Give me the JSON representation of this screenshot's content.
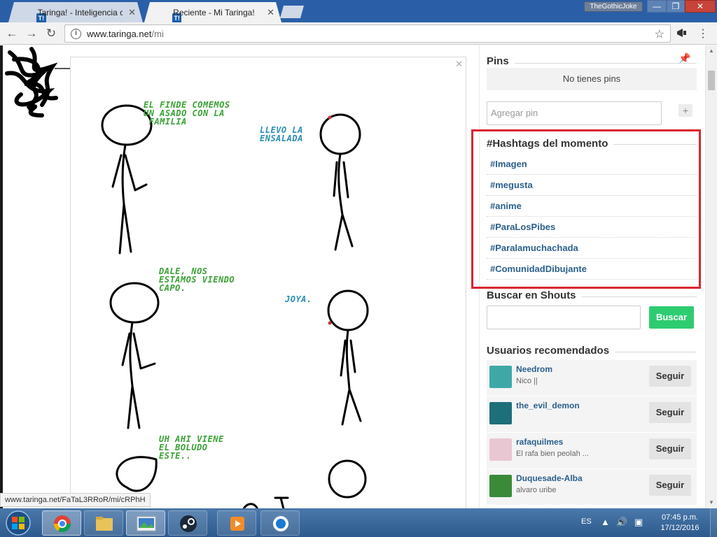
{
  "window": {
    "profile_name": "TheGothicJoke",
    "minimize_label": "—",
    "maximize_label": "❐",
    "close_label": "✕"
  },
  "tabs": [
    {
      "label": "Taringa! - Inteligencia co",
      "favicon": "T!",
      "active": false
    },
    {
      "label": "Reciente - Mi Taringa!",
      "favicon": "T!",
      "active": true
    }
  ],
  "toolbar": {
    "back_icon": "←",
    "forward_icon": "→",
    "reload_icon": "↻",
    "url_host": "www.taringa.net",
    "url_path": "/mi",
    "star_icon": "☆",
    "menu_icon": "⋮"
  },
  "comic": {
    "panels": [
      {
        "left_caption": "EL FINDE COMEMOS\nUN ASADO CON LA\n FAMILIA",
        "right_caption": "LLEVO LA\nENSALADA"
      },
      {
        "left_caption": "DALE, NOS\nESTAMOS VIENDO\nCAPO.",
        "right_caption": "JOYA."
      },
      {
        "left_caption": "UH AHI VIENE\nEL BOLUDO\nESTE..",
        "right_caption": ""
      }
    ]
  },
  "sidebar": {
    "pins_title": "Pins",
    "pins_empty": "No tienes pins",
    "pin_placeholder": "Agregar pin",
    "pin_add_label": "+",
    "hashtags_title": "#Hashtags del momento",
    "hashtags": [
      "#Imagen",
      "#megusta",
      "#anime",
      "#ParaLosPibes",
      "#Paralamuchachada",
      "#ComunidadDibujante"
    ],
    "shouts_title": "Buscar en Shouts",
    "shouts_button": "Buscar",
    "users_title": "Usuarios recomendados",
    "follow_label": "Seguir",
    "users": [
      {
        "name": "Needrom",
        "bio": "Nico ||",
        "avatar_color": "#3fa8a6"
      },
      {
        "name": "the_evil_demon",
        "bio": "",
        "avatar_color": "#1d6f7a"
      },
      {
        "name": "rafaquilmes",
        "bio": "El rafa bien peolah ...",
        "avatar_color": "#e9c7d2"
      },
      {
        "name": "Duquesade-Alba",
        "bio": "alvaro uribe",
        "avatar_color": "#3a8a3a"
      }
    ]
  },
  "status_url": "www.taringa.net/FaTaL3RRoR/mi/cRPhH",
  "taskbar": {
    "language": "ES",
    "time": "07:45 p.m.",
    "date": "17/12/2016"
  },
  "colors": {
    "highlight_border": "#d9252e",
    "hashtag_link": "#2b5f8c",
    "search_button": "#2ecc71",
    "caption_green": "#3aa236",
    "caption_blue": "#2c8fb5"
  }
}
